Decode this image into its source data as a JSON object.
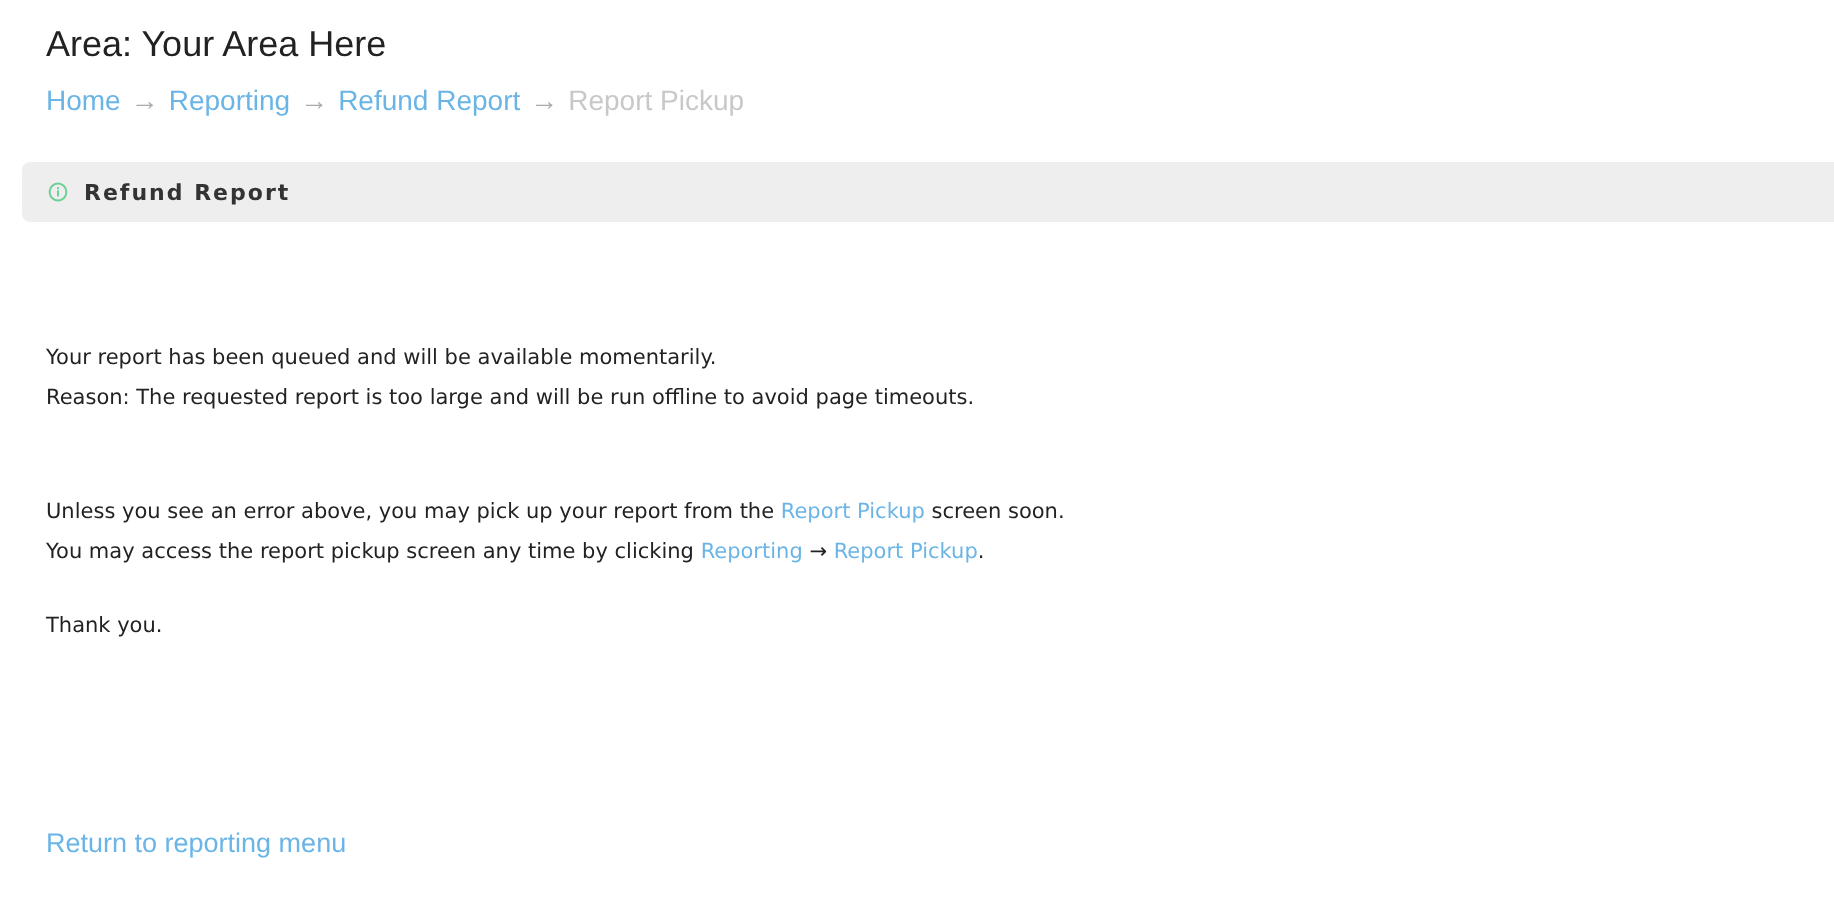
{
  "area_title": "Area: Your Area Here",
  "breadcrumb": [
    {
      "kind": "link",
      "text": "Home"
    },
    {
      "kind": "sep",
      "text": "→"
    },
    {
      "kind": "link",
      "text": "Reporting"
    },
    {
      "kind": "sep",
      "text": "→"
    },
    {
      "kind": "link",
      "text": "Refund Report"
    },
    {
      "kind": "sep",
      "text": "→"
    },
    {
      "kind": "current",
      "text": "Report Pickup"
    }
  ],
  "panel": {
    "title": "Refund Report"
  },
  "paragraphs": [
    [
      [
        {
          "kind": "text",
          "text": "Your report has been queued and will be available momentarily."
        }
      ],
      [
        {
          "kind": "text",
          "text": "Reason: The requested report is too large and will be run offline to avoid page timeouts."
        }
      ]
    ],
    [
      [
        {
          "kind": "text",
          "text": "Unless you see an error above, you may pick up your report from the "
        },
        {
          "kind": "link",
          "text": "Report Pickup"
        },
        {
          "kind": "text",
          "text": " screen soon."
        }
      ],
      [
        {
          "kind": "text",
          "text": "You may access the report pickup screen any time by clicking "
        },
        {
          "kind": "link",
          "text": "Reporting"
        },
        {
          "kind": "text",
          "text": " → "
        },
        {
          "kind": "link",
          "text": "Report Pickup"
        },
        {
          "kind": "text",
          "text": "."
        }
      ]
    ],
    [
      [
        {
          "kind": "text",
          "text": "Thank you."
        }
      ]
    ]
  ],
  "return_link": "Return to reporting menu"
}
